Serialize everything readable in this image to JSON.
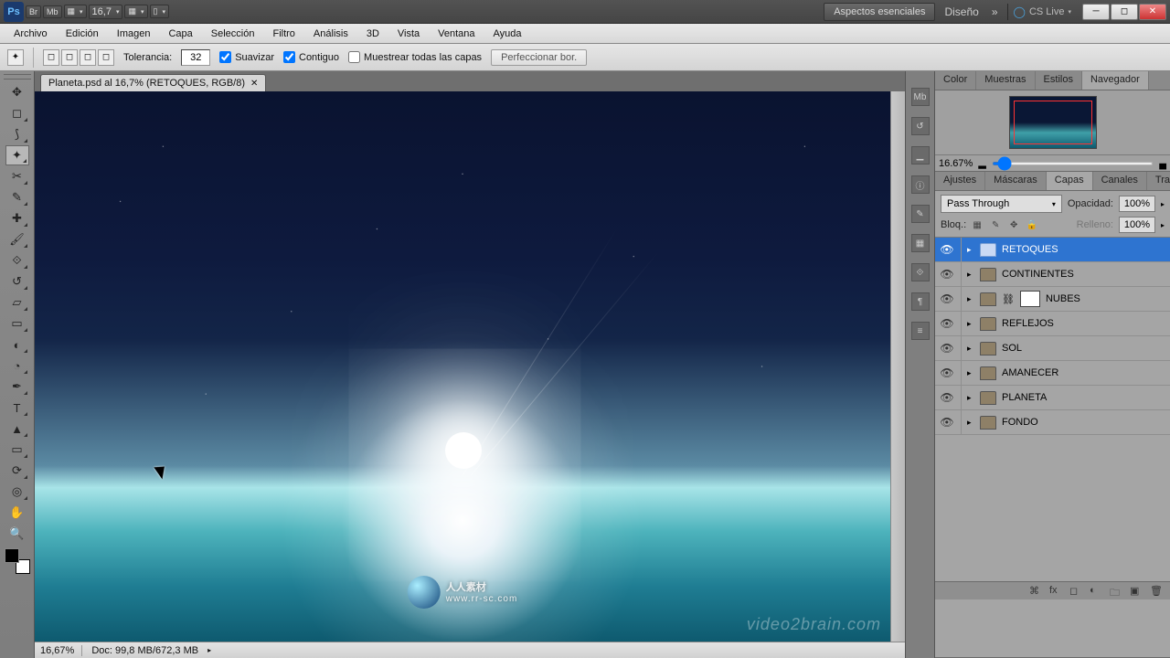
{
  "topbar": {
    "zoom_label": "16,7",
    "workspace_active": "Aspectos esenciales",
    "workspace_other": "Diseño",
    "cs_live": "CS Live"
  },
  "menu": [
    "Archivo",
    "Edición",
    "Imagen",
    "Capa",
    "Selección",
    "Filtro",
    "Análisis",
    "3D",
    "Vista",
    "Ventana",
    "Ayuda"
  ],
  "options": {
    "tolerance_label": "Tolerancia:",
    "tolerance_value": "32",
    "antialias": "Suavizar",
    "contiguous": "Contiguo",
    "sample_all": "Muestrear todas las capas",
    "refine": "Perfeccionar bor."
  },
  "document": {
    "tab_title": "Planeta.psd al 16,7% (RETOQUES, RGB/8)",
    "status_zoom": "16,67%",
    "status_doc": "Doc: 99,8 MB/672,3 MB"
  },
  "panels": {
    "nav_tabs": [
      "Color",
      "Muestras",
      "Estilos",
      "Navegador"
    ],
    "nav_active": 3,
    "nav_zoom": "16.67%",
    "layer_section_tabs": [
      "Ajustes",
      "Máscaras",
      "Capas",
      "Canales",
      "Trazad"
    ],
    "layer_section_active": 2,
    "blend_mode": "Pass Through",
    "opacity_label": "Opacidad:",
    "opacity_value": "100%",
    "lock_label": "Bloq.:",
    "fill_label": "Relleno:",
    "fill_value": "100%",
    "layers": [
      {
        "name": "RETOQUES",
        "selected": true,
        "type": "group"
      },
      {
        "name": "CONTINENTES",
        "type": "group"
      },
      {
        "name": "NUBES",
        "type": "group",
        "mask": true
      },
      {
        "name": "REFLEJOS",
        "type": "group"
      },
      {
        "name": "SOL",
        "type": "group"
      },
      {
        "name": "AMANECER",
        "type": "group"
      },
      {
        "name": "PLANETA",
        "type": "group"
      },
      {
        "name": "FONDO",
        "type": "group"
      }
    ]
  },
  "watermark": {
    "right": "video2brain.com",
    "center": "人人素材",
    "center_sub": "www.rr-sc.com"
  }
}
